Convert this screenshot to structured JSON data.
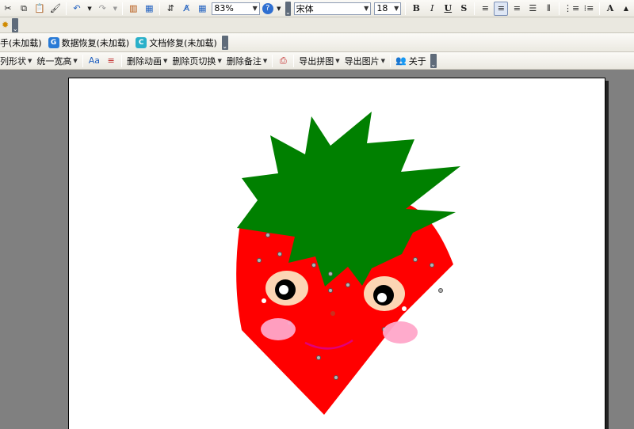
{
  "toolbar1": {
    "zoom": "83%",
    "font_name": "宋体",
    "font_size": "18",
    "bold_label": "B",
    "italic_label": "I",
    "underline_label": "U",
    "shadow_label": "S",
    "grow_font_label": "A"
  },
  "toolbar2": {},
  "toolbar3": {
    "plugins": [
      {
        "label": "手(未加载)",
        "icon": "",
        "color": "#e8a000"
      },
      {
        "label": "数据恢复(未加载)",
        "icon": "G",
        "color": "#2a7bd6"
      },
      {
        "label": "文档修复(未加载)",
        "icon": "C",
        "color": "#2ab0c9"
      }
    ]
  },
  "toolbar4": {
    "items": [
      {
        "label": "列形状",
        "dropdown": true
      },
      {
        "label": "统一宽高",
        "dropdown": true
      },
      {
        "label": "删除动画",
        "dropdown": true
      },
      {
        "label": "删除页切换",
        "dropdown": true
      },
      {
        "label": "删除备注",
        "dropdown": true
      },
      {
        "label": "导出拼图",
        "dropdown": true
      },
      {
        "label": "导出图片",
        "dropdown": true
      },
      {
        "label": "关于",
        "dropdown": false
      }
    ]
  },
  "colors": {
    "strawberry_red": "#ff0000",
    "leaf_green": "#008000",
    "eye_peach": "#fcd5b4",
    "blush_pink": "#ffa6c9",
    "smile": "#e0007a"
  }
}
